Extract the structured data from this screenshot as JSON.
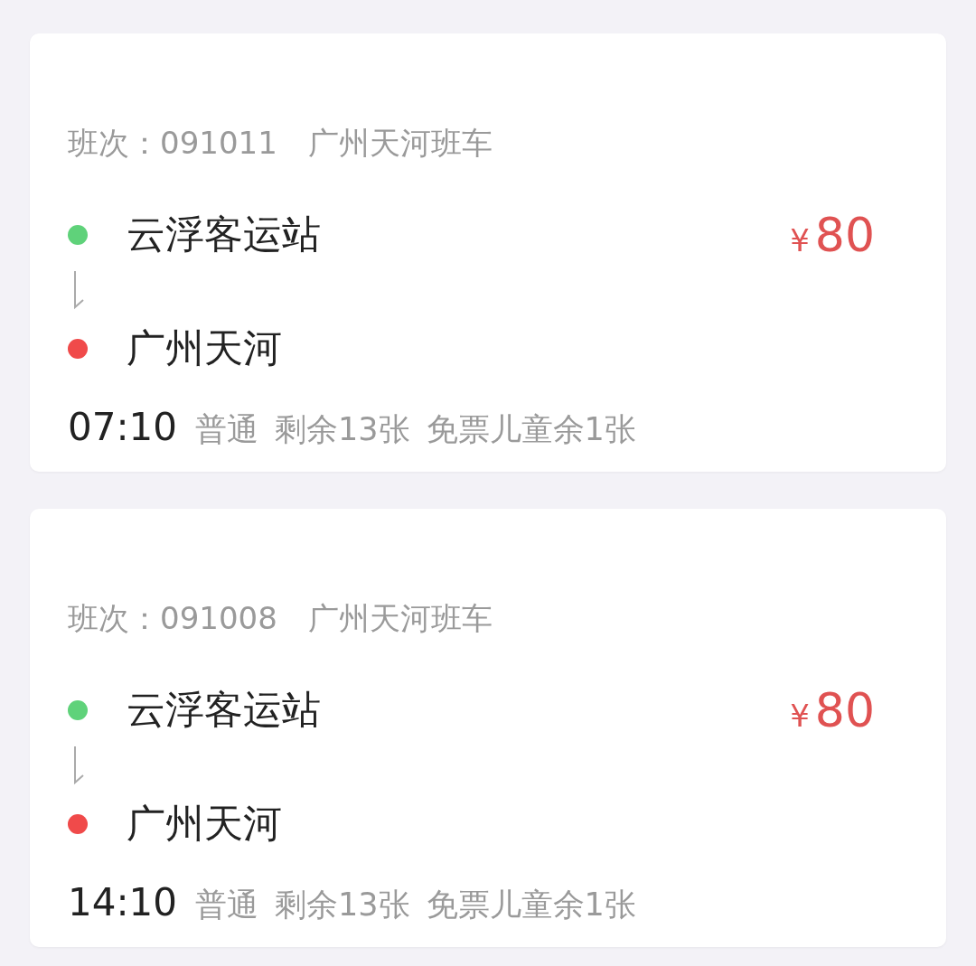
{
  "trips": [
    {
      "trip_no": "班次：091011",
      "route": "广州天河班车",
      "stops": [
        {
          "name": "云浮客运站",
          "color": "#5fd27a"
        },
        {
          "name": "广州天河",
          "color": "#f04a4a"
        }
      ],
      "currency": "¥",
      "price": "80",
      "time": "07:10",
      "details": [
        "普通",
        "剩余13张",
        "免票儿童余1张"
      ]
    },
    {
      "trip_no": "班次：091008",
      "route": "广州天河班车",
      "stops": [
        {
          "name": "云浮客运站",
          "color": "#5fd27a"
        },
        {
          "name": "广州天河",
          "color": "#f04a4a"
        }
      ],
      "currency": "¥",
      "price": "80",
      "time": "14:10",
      "details": [
        "普通",
        "剩余13张",
        "免票儿童余1张"
      ]
    }
  ]
}
